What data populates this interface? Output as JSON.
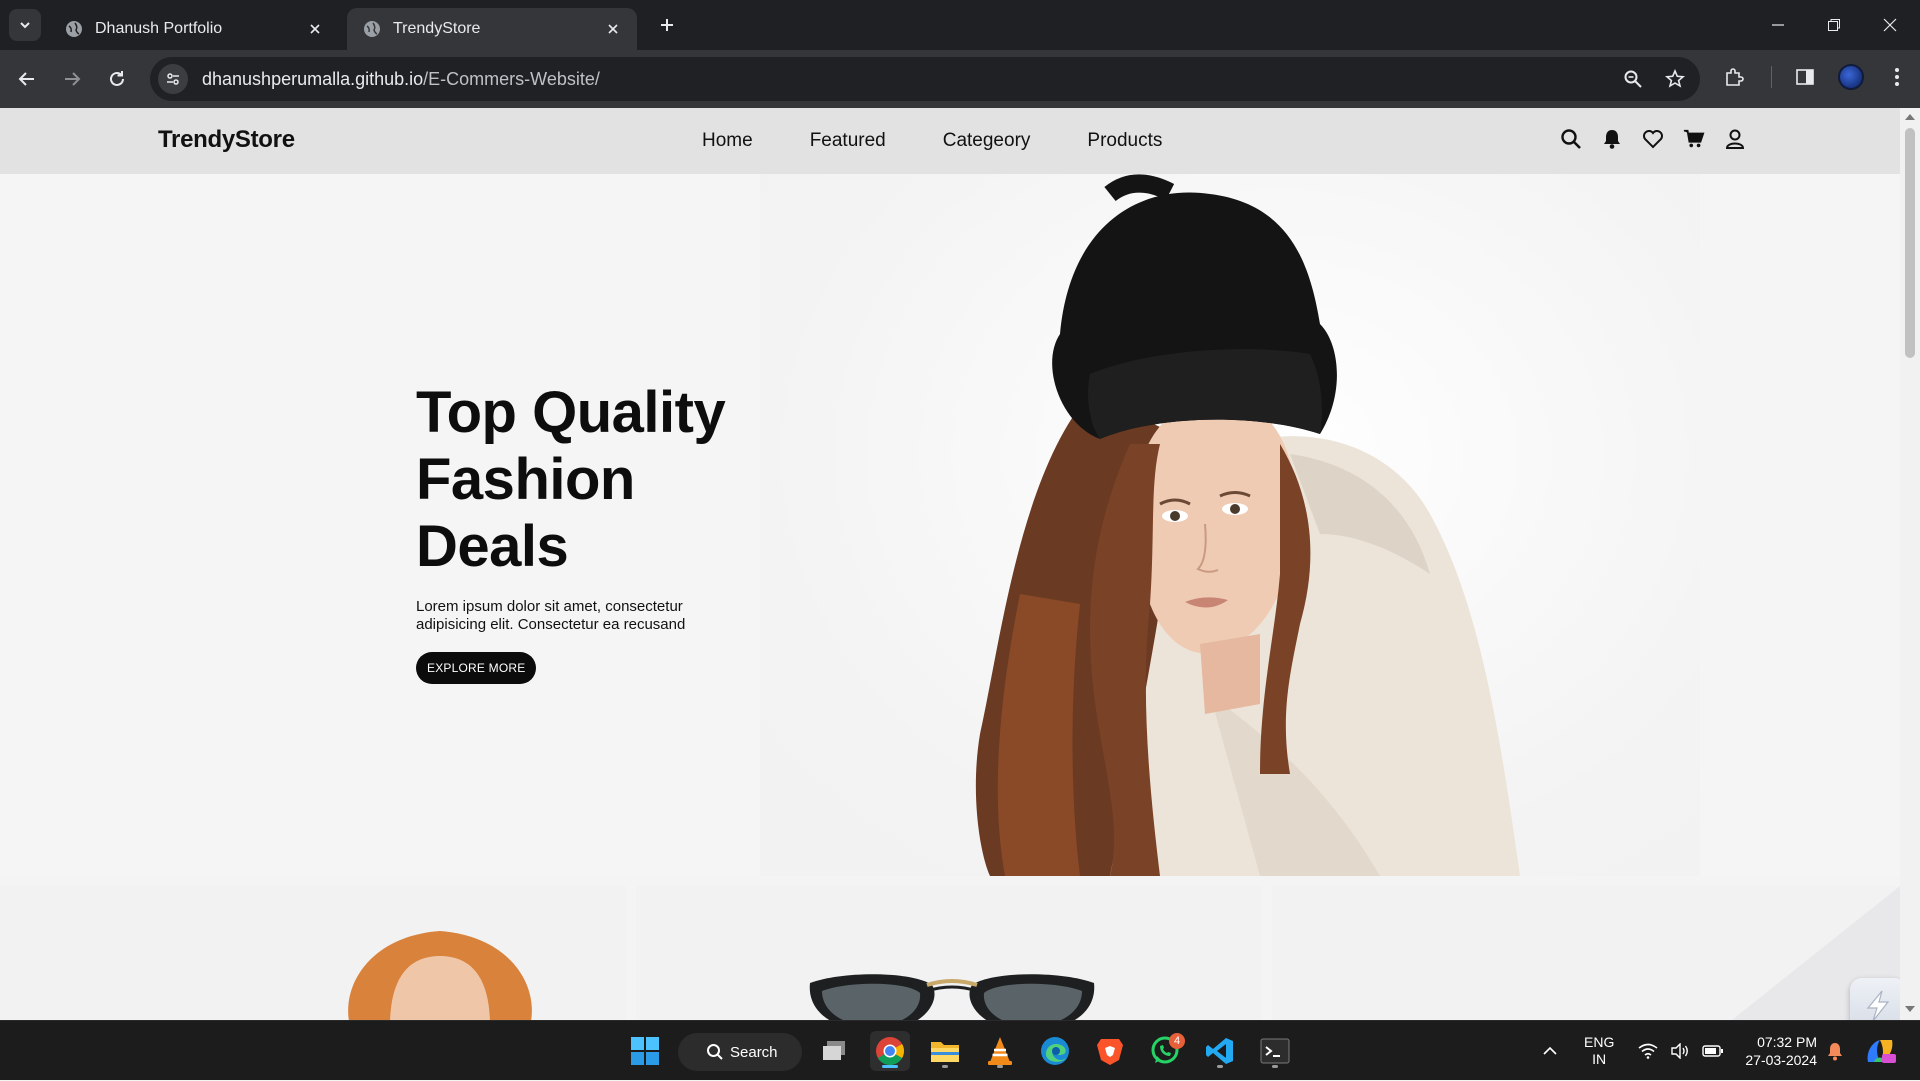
{
  "browser": {
    "tabs": [
      {
        "title": "Dhanush Portfolio",
        "active": false
      },
      {
        "title": "TrendyStore",
        "active": true
      }
    ],
    "url_host": "dhanushperumalla.github.io",
    "url_path": "/E-Commers-Website/"
  },
  "site": {
    "logo": "TrendyStore",
    "nav": [
      "Home",
      "Featured",
      "Categeory",
      "Products"
    ],
    "header_icons": [
      "search-icon",
      "bell-icon",
      "heart-icon",
      "cart-icon",
      "user-icon"
    ]
  },
  "hero": {
    "title": "Top Quality Fashion Deals",
    "subtitle": "Lorem ipsum dolor sit amet, consectetur adipisicing elit. Consectetur ea recusand",
    "cta": "EXPLORE MORE"
  },
  "taskbar": {
    "search_label": "Search",
    "whatsapp_badge": "4",
    "language_line1": "ENG",
    "language_line2": "IN",
    "time": "07:32 PM",
    "date": "27-03-2024"
  },
  "colors": {
    "chrome_dark": "#1f2023",
    "toolbar": "#35363a",
    "header_bg": "#e2e2e3",
    "cta_bg": "#0b0b0b",
    "accent_blue": "#4cc2ff"
  }
}
